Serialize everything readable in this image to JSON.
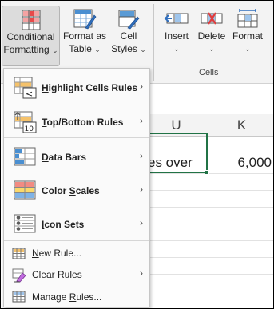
{
  "ribbon": {
    "conditional_formatting": {
      "line1": "Conditional",
      "line2": "Formatting",
      "chevron": "⌄",
      "icon": "conditional-formatting-icon"
    },
    "format_as_table": {
      "line1": "Format as",
      "line2": "Table",
      "chevron": "⌄",
      "icon": "format-as-table-icon"
    },
    "cell_styles": {
      "line1": "Cell",
      "line2": "Styles",
      "chevron": "⌄",
      "icon": "cell-styles-icon"
    },
    "insert": {
      "line1": "Insert",
      "chevron": "⌄",
      "icon": "insert-cells-icon"
    },
    "delete": {
      "line1": "Delete",
      "chevron": "⌄",
      "icon": "delete-cells-icon"
    },
    "format": {
      "line1": "Format",
      "chevron": "⌄",
      "icon": "format-cells-icon"
    },
    "cells_group_label": "Cells"
  },
  "sheet": {
    "col_u": "U",
    "col_k": "K",
    "cell_u_text": "es over",
    "cell_k_value": "6,000",
    "accent": "#217346"
  },
  "menu": {
    "items": [
      {
        "pre": "",
        "ul": "H",
        "post": "ighlight Cells Rules",
        "icon": "highlight-cells-rules-icon",
        "submenu": "›"
      },
      {
        "pre": "",
        "ul": "T",
        "post": "op/Bottom Rules",
        "icon": "top-bottom-rules-icon",
        "submenu": "›"
      },
      {
        "pre": "",
        "ul": "D",
        "post": "ata Bars",
        "icon": "data-bars-icon",
        "submenu": "›"
      },
      {
        "pre": "Color ",
        "ul": "S",
        "post": "cales",
        "icon": "color-scales-icon",
        "submenu": "›"
      },
      {
        "pre": "",
        "ul": "I",
        "post": "con Sets",
        "icon": "icon-sets-icon",
        "submenu": "›"
      },
      {
        "pre": "",
        "ul": "N",
        "post": "ew Rule...",
        "icon": "new-rule-icon",
        "submenu": ""
      },
      {
        "pre": "",
        "ul": "C",
        "post": "lear Rules",
        "icon": "clear-rules-icon",
        "submenu": "›"
      },
      {
        "pre": "Manage ",
        "ul": "R",
        "post": "ules...",
        "icon": "manage-rules-icon",
        "submenu": ""
      }
    ]
  }
}
